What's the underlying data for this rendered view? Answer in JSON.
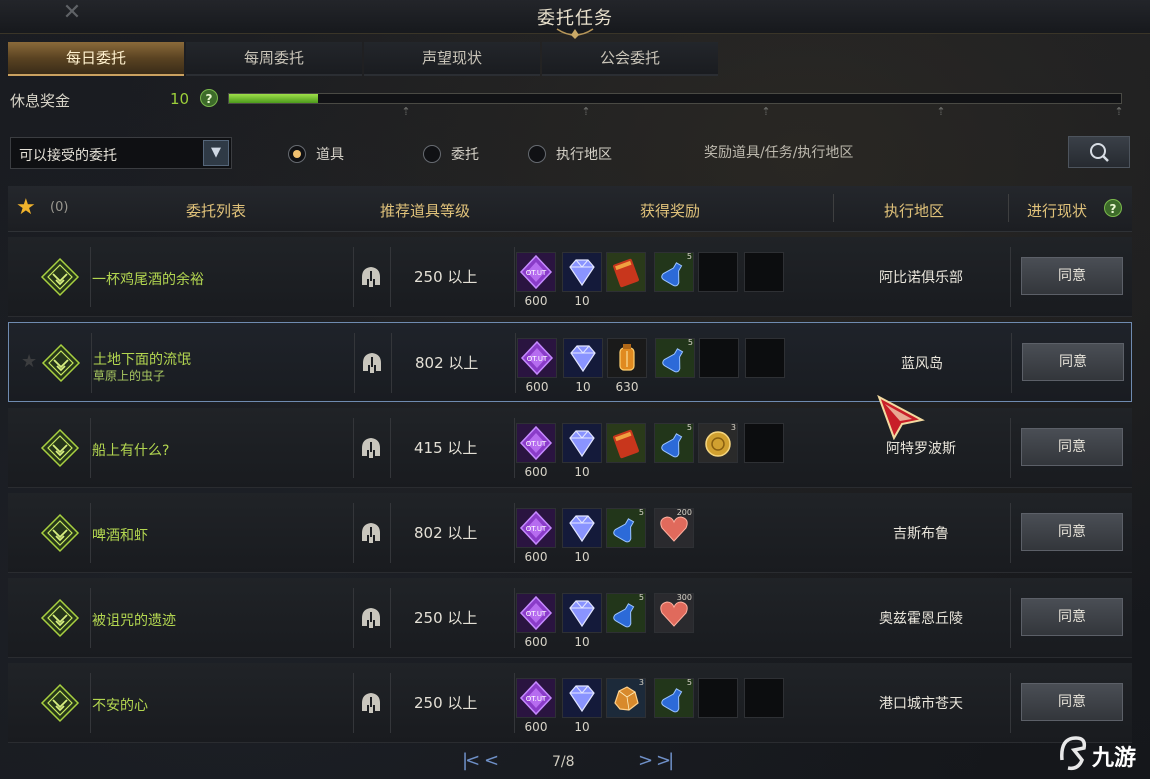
{
  "window": {
    "title": "委托任务",
    "close_glyph": "✕"
  },
  "tabs": [
    {
      "label": "每日委托",
      "active": true
    },
    {
      "label": "每周委托",
      "active": false
    },
    {
      "label": "声望现状",
      "active": false
    },
    {
      "label": "公会委托",
      "active": false
    }
  ],
  "rest_bonus": {
    "label": "休息奖金",
    "value": "10",
    "help": "?",
    "progress": 0.1
  },
  "filter": {
    "dropdown_value": "可以接受的委托",
    "radios": [
      {
        "label": "道具",
        "selected": true
      },
      {
        "label": "委托",
        "selected": false
      },
      {
        "label": "执行地区",
        "selected": false
      }
    ],
    "search_placeholder": "奖励道具/任务/执行地区"
  },
  "table_header": {
    "favorites_count": "(0)",
    "col_list": "委托列表",
    "col_level": "推荐道具等级",
    "col_rewards": "获得奖励",
    "col_region": "执行地区",
    "col_status": "进行现状",
    "status_help": "?"
  },
  "rows": [
    {
      "name": "一杯鸡尾酒的余裕",
      "sub": "",
      "level": "250 以上",
      "region": "阿比诺俱乐部",
      "button": "同意",
      "rewards": [
        {
          "kind": "purple-crystal",
          "count": "",
          "num": "600"
        },
        {
          "kind": "diamond",
          "count": "",
          "num": "10"
        },
        {
          "kind": "red-book",
          "count": "",
          "num": ""
        },
        {
          "kind": "blue-potion",
          "count": "5",
          "num": ""
        },
        {
          "kind": "empty",
          "count": "",
          "num": ""
        },
        {
          "kind": "empty",
          "count": "",
          "num": ""
        }
      ]
    },
    {
      "name": "土地下面的流氓",
      "sub": "草原上的虫子",
      "level": "802 以上",
      "region": "蓝风岛",
      "button": "同意",
      "rewards": [
        {
          "kind": "purple-crystal",
          "count": "",
          "num": "600"
        },
        {
          "kind": "diamond",
          "count": "",
          "num": "10"
        },
        {
          "kind": "lantern",
          "count": "",
          "num": "630"
        },
        {
          "kind": "blue-potion",
          "count": "5",
          "num": ""
        },
        {
          "kind": "empty",
          "count": "",
          "num": ""
        },
        {
          "kind": "empty",
          "count": "",
          "num": ""
        }
      ]
    },
    {
      "name": "船上有什么?",
      "sub": "",
      "level": "415 以上",
      "region": "阿特罗波斯",
      "button": "同意",
      "rewards": [
        {
          "kind": "purple-crystal",
          "count": "",
          "num": "600"
        },
        {
          "kind": "diamond",
          "count": "",
          "num": "10"
        },
        {
          "kind": "red-book",
          "count": "",
          "num": ""
        },
        {
          "kind": "blue-potion",
          "count": "5",
          "num": ""
        },
        {
          "kind": "gold-coin",
          "count": "3",
          "num": ""
        },
        {
          "kind": "empty",
          "count": "",
          "num": ""
        }
      ]
    },
    {
      "name": "啤酒和虾",
      "sub": "",
      "level": "802 以上",
      "region": "吉斯布鲁",
      "button": "同意",
      "rewards": [
        {
          "kind": "purple-crystal",
          "count": "",
          "num": "600"
        },
        {
          "kind": "diamond",
          "count": "",
          "num": "10"
        },
        {
          "kind": "blue-potion",
          "count": "5",
          "num": ""
        },
        {
          "kind": "red-heart",
          "count": "200",
          "num": ""
        },
        {
          "kind": "blank",
          "count": "",
          "num": ""
        },
        {
          "kind": "blank",
          "count": "",
          "num": ""
        }
      ]
    },
    {
      "name": "被诅咒的遗迹",
      "sub": "",
      "level": "250 以上",
      "region": "奥兹霍恩丘陵",
      "button": "同意",
      "rewards": [
        {
          "kind": "purple-crystal",
          "count": "",
          "num": "600"
        },
        {
          "kind": "diamond",
          "count": "",
          "num": "10"
        },
        {
          "kind": "blue-potion",
          "count": "5",
          "num": ""
        },
        {
          "kind": "red-heart",
          "count": "300",
          "num": ""
        },
        {
          "kind": "blank",
          "count": "",
          "num": ""
        },
        {
          "kind": "blank",
          "count": "",
          "num": ""
        }
      ]
    },
    {
      "name": "不安的心",
      "sub": "",
      "level": "250 以上",
      "region": "港口城市苍天",
      "button": "同意",
      "rewards": [
        {
          "kind": "purple-crystal",
          "count": "",
          "num": "600"
        },
        {
          "kind": "diamond",
          "count": "",
          "num": "10"
        },
        {
          "kind": "gold-ore",
          "count": "3",
          "num": ""
        },
        {
          "kind": "blue-potion",
          "count": "5",
          "num": ""
        },
        {
          "kind": "empty",
          "count": "",
          "num": ""
        },
        {
          "kind": "empty",
          "count": "",
          "num": ""
        }
      ]
    }
  ],
  "pagination": {
    "first": "|<",
    "prev": "<",
    "current": "7/8",
    "next": ">",
    "last": ">|"
  },
  "watermark": {
    "text": "九游"
  }
}
